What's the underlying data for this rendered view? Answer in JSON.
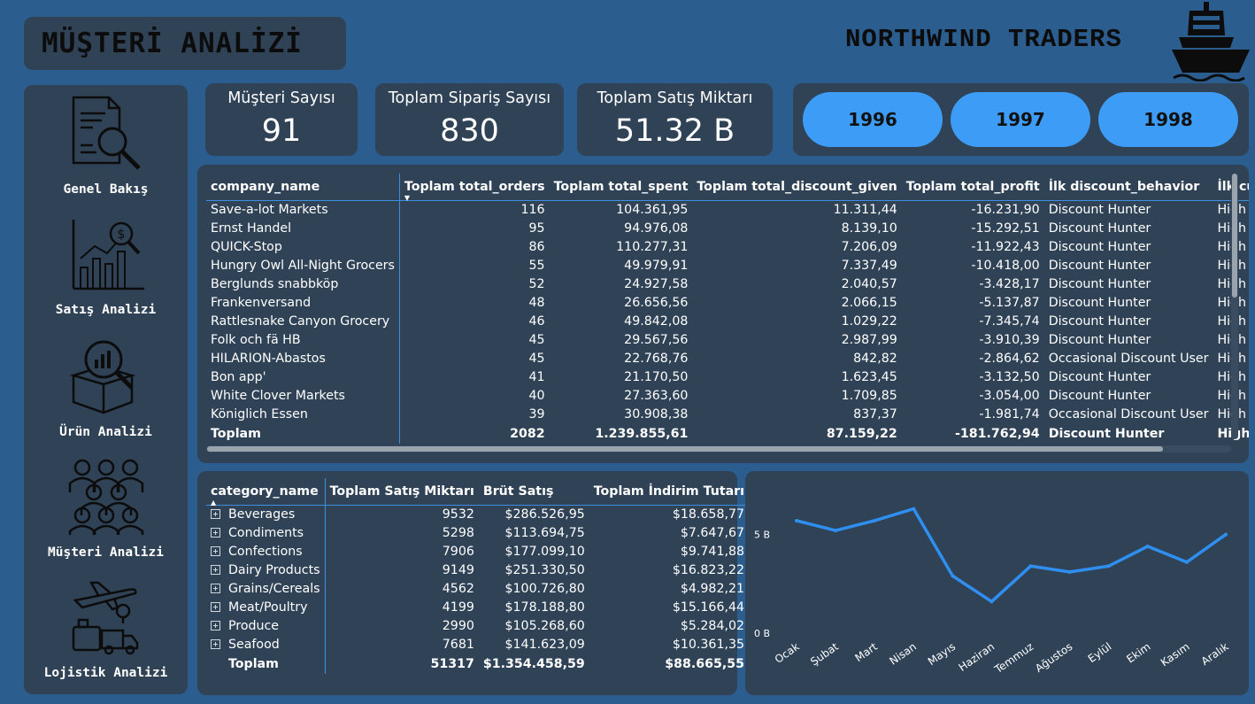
{
  "header": {
    "title": "MÜŞTERİ ANALİZİ",
    "brand": "NORTHWIND TRADERS"
  },
  "sidebar": {
    "items": [
      {
        "label": "Genel Bakış",
        "icon": "document-search-icon"
      },
      {
        "label": "Satış Analizi",
        "icon": "sales-chart-icon"
      },
      {
        "label": "Ürün Analizi",
        "icon": "product-box-icon"
      },
      {
        "label": "Müşteri Analizi",
        "icon": "customers-group-icon"
      },
      {
        "label": "Lojistik Analizi",
        "icon": "logistics-icon"
      }
    ]
  },
  "kpis": [
    {
      "label": "Müşteri Sayısı",
      "value": "91"
    },
    {
      "label": "Toplam Sipariş Sayısı",
      "value": "830"
    },
    {
      "label": "Toplam Satış Miktarı",
      "value": "51.32 B"
    }
  ],
  "year_filter": [
    "1996",
    "1997",
    "1998"
  ],
  "customer_table": {
    "columns": [
      "company_name",
      "Toplam total_orders",
      "Toplam total_spent",
      "Toplam total_discount_given",
      "Toplam total_profit",
      "İlk discount_behavior",
      "İlk customer_segment"
    ],
    "rows": [
      [
        "Save-a-lot Markets",
        "116",
        "104.361,95",
        "11.311,44",
        "-16.231,90",
        "Discount Hunter",
        "High Value Customer"
      ],
      [
        "Ernst Handel",
        "95",
        "94.976,08",
        "8.139,10",
        "-15.292,51",
        "Discount Hunter",
        "High Value Customer"
      ],
      [
        "QUICK-Stop",
        "86",
        "110.277,31",
        "7.206,09",
        "-11.922,43",
        "Discount Hunter",
        "High Value Customer"
      ],
      [
        "Hungry Owl All-Night Grocers",
        "55",
        "49.979,91",
        "7.337,49",
        "-10.418,00",
        "Discount Hunter",
        "High Value Customer"
      ],
      [
        "Berglunds snabbköp",
        "52",
        "24.927,58",
        "2.040,57",
        "-3.428,17",
        "Discount Hunter",
        "High Value Customer"
      ],
      [
        "Frankenversand",
        "48",
        "26.656,56",
        "2.066,15",
        "-5.137,87",
        "Discount Hunter",
        "High Value Customer"
      ],
      [
        "Rattlesnake Canyon Grocery",
        "46",
        "49.842,08",
        "1.029,22",
        "-7.345,74",
        "Discount Hunter",
        "High Value Customer"
      ],
      [
        "Folk och fä HB",
        "45",
        "29.567,56",
        "2.987,99",
        "-3.910,39",
        "Discount Hunter",
        "High Value Customer"
      ],
      [
        "HILARION-Abastos",
        "45",
        "22.768,76",
        "842,82",
        "-2.864,62",
        "Occasional Discount User",
        "High Value Customer"
      ],
      [
        "Bon app'",
        "41",
        "21.170,50",
        "1.623,45",
        "-3.132,50",
        "Discount Hunter",
        "High Value Customer"
      ],
      [
        "White Clover Markets",
        "40",
        "27.363,60",
        "1.709,85",
        "-3.054,00",
        "Discount Hunter",
        "High Value Customer"
      ],
      [
        "Königlich Essen",
        "39",
        "30.908,38",
        "837,37",
        "-1.981,74",
        "Occasional Discount User",
        "High Value Customer"
      ]
    ],
    "total": [
      "Toplam",
      "2082",
      "1.239.855,61",
      "87.159,22",
      "-181.762,94",
      "Discount Hunter",
      "High Value Customer"
    ]
  },
  "category_table": {
    "columns": [
      "category_name",
      "Toplam Satış Miktarı",
      "Brüt Satış",
      "Toplam İndirim Tutarı"
    ],
    "rows": [
      [
        "Beverages",
        "9532",
        "$286.526,95",
        "$18.658,77"
      ],
      [
        "Condiments",
        "5298",
        "$113.694,75",
        "$7.647,67"
      ],
      [
        "Confections",
        "7906",
        "$177.099,10",
        "$9.741,88"
      ],
      [
        "Dairy Products",
        "9149",
        "$251.330,50",
        "$16.823,22"
      ],
      [
        "Grains/Cereals",
        "4562",
        "$100.726,80",
        "$4.982,21"
      ],
      [
        "Meat/Poultry",
        "4199",
        "$178.188,80",
        "$15.166,44"
      ],
      [
        "Produce",
        "2990",
        "$105.268,60",
        "$5.284,02"
      ],
      [
        "Seafood",
        "7681",
        "$141.623,09",
        "$10.361,35"
      ]
    ],
    "total": [
      "Toplam",
      "51317",
      "$1.354.458,59",
      "$88.665,55"
    ]
  },
  "chart_data": {
    "type": "line",
    "categories": [
      "Ocak",
      "Şubat",
      "Mart",
      "Nisan",
      "Mayıs",
      "Haziran",
      "Temmuz",
      "Ağustos",
      "Eylül",
      "Ekim",
      "Kasım",
      "Aralık"
    ],
    "values": [
      5.7,
      5.2,
      5.7,
      6.3,
      2.9,
      1.6,
      3.4,
      3.1,
      3.4,
      4.4,
      3.6,
      5.0
    ],
    "y_ticks": [
      "0 B",
      "5 B"
    ],
    "ylim": [
      0,
      7
    ],
    "color": "#2f8ff0"
  },
  "colors": {
    "background": "#2b5d8f",
    "panel": "#2f4256",
    "accent": "#3d9cf5"
  }
}
